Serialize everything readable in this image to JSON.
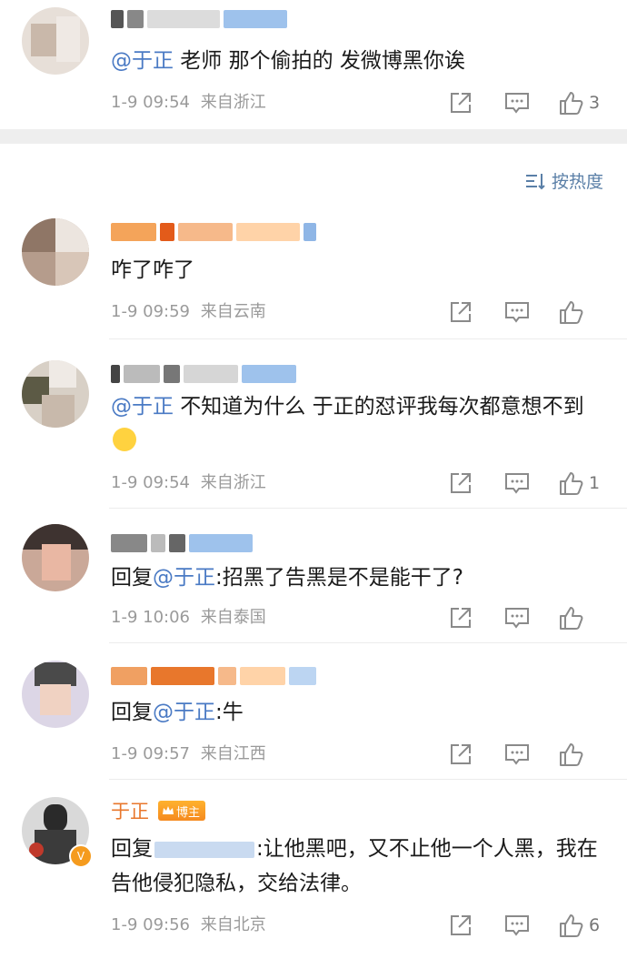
{
  "comments": [
    {
      "text_mention": "@于正",
      "text": " 老师 那个偷拍的 发微博黑你诶",
      "time": "1-9 09:54",
      "location": "来自浙江",
      "likes": "3"
    },
    {
      "text": "咋了咋了",
      "time": "1-9 09:59",
      "location": "来自云南",
      "likes": ""
    },
    {
      "text_mention": "@于正",
      "text": " 不知道为什么 于正的怼评我每次都意想不到",
      "time": "1-9 09:54",
      "location": "来自浙江",
      "likes": "1"
    },
    {
      "reply_prefix": "回复",
      "text_mention": "@于正",
      "text": ":招黑了告黑是不是能干了?",
      "time": "1-9 10:06",
      "location": "来自泰国",
      "likes": ""
    },
    {
      "reply_prefix": "回复",
      "text_mention": "@于正",
      "text": ":牛",
      "time": "1-9 09:57",
      "location": "来自江西",
      "likes": ""
    },
    {
      "name": "于正",
      "badge": "博主",
      "reply_prefix": "回复",
      "text": ":让他黑吧，又不止他一个人黑，我在告他侵犯隐私，交给法律。",
      "time": "1-9 09:56",
      "location": "来自北京",
      "likes": "6"
    }
  ],
  "sort": {
    "label": "按热度",
    "icon": "sort-icon"
  },
  "icons": {
    "share": "share-icon",
    "comment": "comment-icon",
    "like": "thumbs-up-icon"
  },
  "colors": {
    "mention": "#4a7ac4",
    "meta": "#9a9a9a",
    "badge": "#f59b1e",
    "sort": "#5a7fa7"
  }
}
